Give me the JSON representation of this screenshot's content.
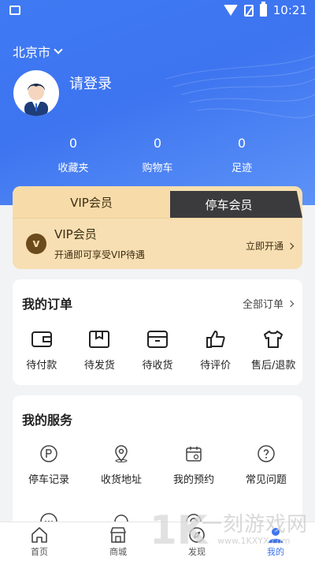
{
  "status_bar": {
    "time": "10:21"
  },
  "header": {
    "city": "北京市",
    "login_prompt": "请登录",
    "stats": [
      {
        "value": "0",
        "label": "收藏夹"
      },
      {
        "value": "0",
        "label": "购物车"
      },
      {
        "value": "0",
        "label": "足迹"
      }
    ]
  },
  "vip": {
    "tabs": [
      "VIP会员",
      "停车会员"
    ],
    "logo_letter": "v",
    "title": "VIP会员",
    "description": "开通即可享受VIP待遇",
    "action": "立即开通"
  },
  "orders": {
    "title": "我的订单",
    "more": "全部订单",
    "items": [
      {
        "label": "待付款",
        "icon": "wallet-icon"
      },
      {
        "label": "待发货",
        "icon": "box-icon"
      },
      {
        "label": "待收货",
        "icon": "package-icon"
      },
      {
        "label": "待评价",
        "icon": "thumbs-up-icon"
      },
      {
        "label": "售后/退款",
        "icon": "shirt-icon"
      }
    ]
  },
  "services": {
    "title": "我的服务",
    "items": [
      {
        "label": "停车记录",
        "icon": "parking-icon"
      },
      {
        "label": "收货地址",
        "icon": "location-pin-icon"
      },
      {
        "label": "我的预约",
        "icon": "calendar-icon"
      },
      {
        "label": "常见问题",
        "icon": "question-icon"
      }
    ]
  },
  "tabbar": {
    "items": [
      {
        "label": "首页",
        "icon": "home-icon"
      },
      {
        "label": "商城",
        "icon": "store-icon"
      },
      {
        "label": "发现",
        "icon": "compass-icon"
      },
      {
        "label": "我的",
        "icon": "user-icon",
        "active": true
      }
    ]
  },
  "watermark": {
    "text": "一刻游戏网",
    "url": "www.1KXYX.com",
    "logo": "1K"
  },
  "colors": {
    "primary": "#3c74ef",
    "vip_gold": "#f7dcaa",
    "vip_dark": "#3b3b3d"
  }
}
